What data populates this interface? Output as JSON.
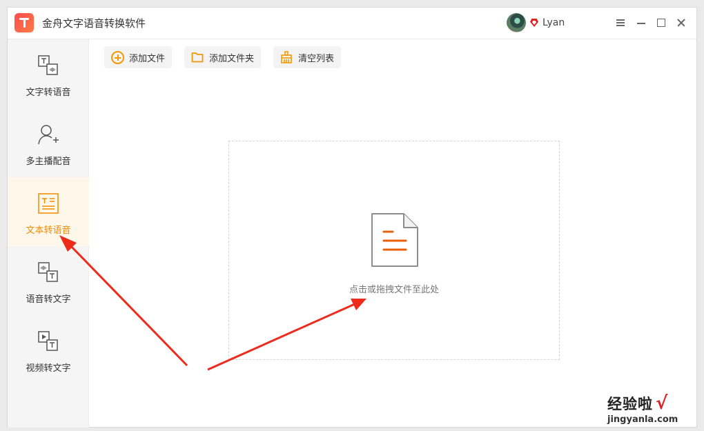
{
  "app": {
    "title": "金舟文字语音转换软件",
    "username": "Lyan",
    "logo_icon": "app-logo",
    "accent_color": "#f39800"
  },
  "sidebar": {
    "items": [
      {
        "label": "文字转语音",
        "icon": "text-to-speech-icon",
        "active": false
      },
      {
        "label": "多主播配音",
        "icon": "add-user-icon",
        "active": false
      },
      {
        "label": "文本转语音",
        "icon": "document-text-icon",
        "active": true
      },
      {
        "label": "语音转文字",
        "icon": "speech-to-text-icon",
        "active": false
      },
      {
        "label": "视频转文字",
        "icon": "video-to-text-icon",
        "active": false
      }
    ]
  },
  "toolbar": {
    "add_file": "添加文件",
    "add_folder": "添加文件夹",
    "clear_list": "清空列表"
  },
  "dropzone": {
    "text": "点击或拖拽文件至此处",
    "icon": "document-icon"
  },
  "annotations": {
    "arrow_color": "#ee2a1b"
  },
  "watermark": {
    "text": "经验啦",
    "check": "√",
    "url": "jingyanla.com"
  }
}
